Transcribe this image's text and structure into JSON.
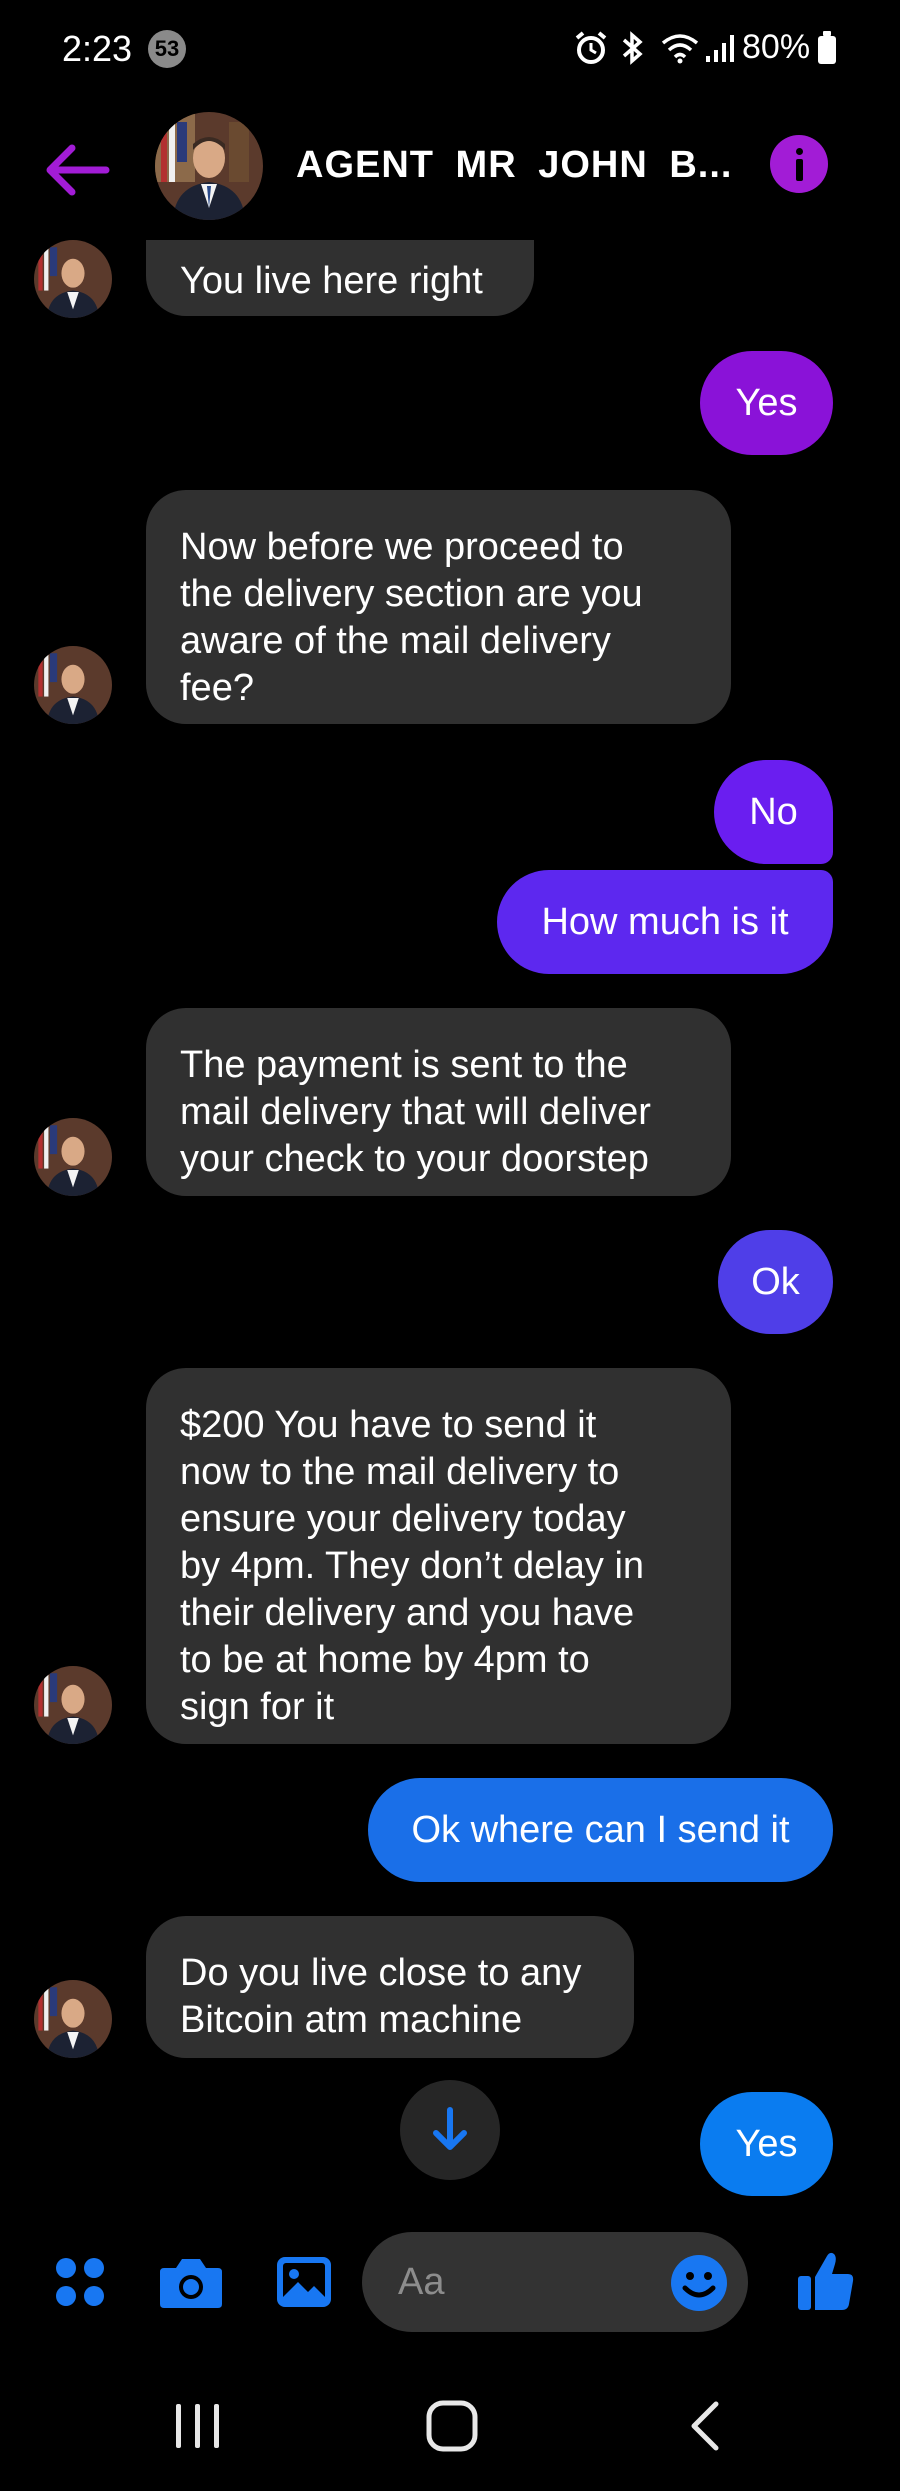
{
  "status_bar": {
    "time": "2:23",
    "notification_count": "53",
    "battery": "80%"
  },
  "header": {
    "contact_name": "AGENT  MR  JOHN  B..."
  },
  "messages": [
    {
      "text": "You live here right"
    },
    {
      "text": "Yes"
    },
    {
      "text": "Now before we proceed to\nthe delivery section are you\naware of the mail delivery\nfee?"
    },
    {
      "text": "No"
    },
    {
      "text": "How much is it"
    },
    {
      "text": "The payment is sent to the\nmail delivery that will deliver\nyour check to your doorstep"
    },
    {
      "text": "Ok"
    },
    {
      "text": "$200 You have to send it\nnow to the mail delivery to\nensure your delivery today\nby 4pm. They don’t delay in\ntheir delivery and you have\nto be at home by 4pm to\nsign for it"
    },
    {
      "text": "Ok where can I send it"
    },
    {
      "text": "Do you live close to any\nBitcoin atm machine"
    },
    {
      "text": "Yes"
    }
  ],
  "composer": {
    "placeholder": "Aa"
  },
  "colors": {
    "accent": "#a21cd6",
    "incoming_bubble": "#303030",
    "outgoing_purple": "#8a12d8",
    "outgoing_violet": "#6a1ef0",
    "outgoing_indigo": "#4f3ee8",
    "outgoing_blue": "#1a6fe8",
    "outgoing_bright_blue": "#0a7cf0",
    "composer_icons": "#1877f2"
  }
}
